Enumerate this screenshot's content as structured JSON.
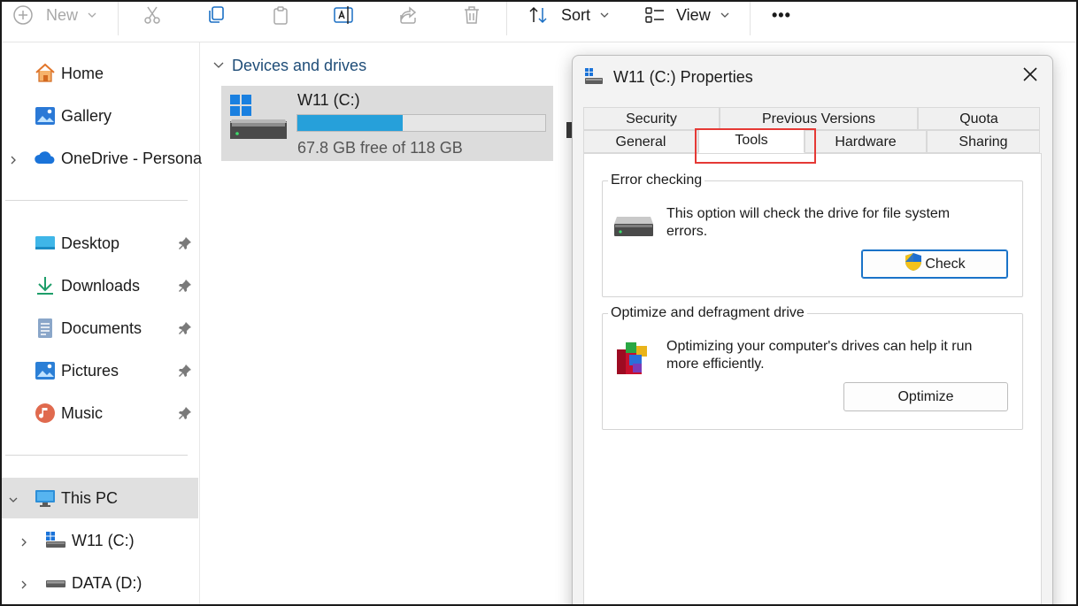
{
  "toolbar": {
    "new_label": "New",
    "sort_label": "Sort",
    "view_label": "View",
    "more_label": "•••"
  },
  "sidebar": {
    "items": [
      {
        "label": "Home",
        "icon": "home-icon"
      },
      {
        "label": "Gallery",
        "icon": "gallery-icon"
      },
      {
        "label": "OneDrive - Persona",
        "icon": "onedrive-cloud-icon"
      },
      {
        "label": "Desktop",
        "icon": "desktop-folder-icon"
      },
      {
        "label": "Downloads",
        "icon": "download-arrow-icon"
      },
      {
        "label": "Documents",
        "icon": "documents-icon"
      },
      {
        "label": "Pictures",
        "icon": "pictures-icon"
      },
      {
        "label": "Music",
        "icon": "music-icon"
      },
      {
        "label": "This PC",
        "icon": "monitor-icon"
      },
      {
        "label": "W11 (C:)",
        "icon": "windows-drive-icon"
      },
      {
        "label": "DATA (D:)",
        "icon": "drive-icon"
      }
    ]
  },
  "main": {
    "section_title": "Devices and drives",
    "drive": {
      "name": "W11 (C:)",
      "free_text": "67.8 GB free of 118 GB",
      "used_fraction": 0.425
    }
  },
  "dialog": {
    "title": "W11 (C:) Properties",
    "tabs_row1": [
      "Security",
      "Previous Versions",
      "Quota"
    ],
    "tabs_row2": [
      "General",
      "Tools",
      "Hardware",
      "Sharing"
    ],
    "active_tab": "Tools",
    "error_checking": {
      "legend": "Error checking",
      "text": "This option will check the drive for file system errors.",
      "button": "Check"
    },
    "optimize": {
      "legend": "Optimize and defragment drive",
      "text": "Optimizing your computer's drives can help it run more efficiently.",
      "button": "Optimize"
    }
  },
  "colors": {
    "accent": "#26a0da",
    "highlight": "#e53935",
    "section_title": "#1f4d78"
  }
}
